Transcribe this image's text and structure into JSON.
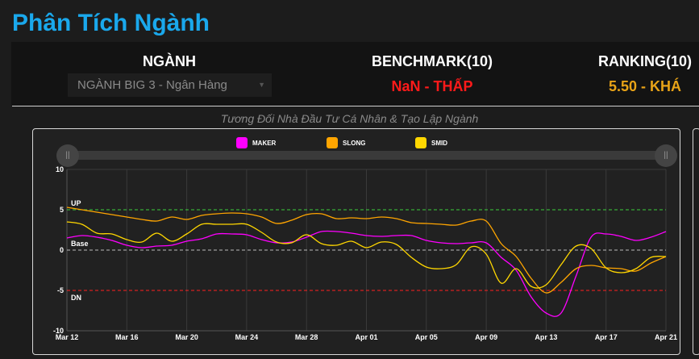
{
  "page_title": "Phân Tích Ngành",
  "header": {
    "sector_label": "NGÀNH",
    "sector_select_value": "NGÀNH BIG 3 - Ngân Hàng",
    "benchmark_label": "BENCHMARK(10)",
    "benchmark_value": "NaN - THẤP",
    "benchmark_color": "#ff1a1a",
    "ranking_label": "RANKING(10)",
    "ranking_value": "5.50 - KHÁ",
    "ranking_color": "#e8a317"
  },
  "chart_subtitle": "Tương Đối Nhà Đầu Tư Cá Nhân & Tạo Lập Ngành",
  "chart_data": {
    "type": "line",
    "title": "Tương Đối Nhà Đầu Tư Cá Nhân & Tạo Lập Ngành",
    "x_ticks": [
      "Mar 12",
      "Mar 16",
      "Mar 20",
      "Mar 24",
      "Mar 28",
      "Apr 01",
      "Apr 05",
      "Apr 09",
      "Apr 13",
      "Apr 17",
      "Apr 21"
    ],
    "x_day_count": 40,
    "ylim": [
      -10,
      10
    ],
    "y_ticks": [
      10,
      5,
      0,
      -5,
      -10
    ],
    "grid": true,
    "legend_position": "top-center",
    "reference_lines": [
      {
        "label": "UP",
        "value": 5,
        "color": "#3ccf3c"
      },
      {
        "label": "Base",
        "value": 0,
        "color": "#bbbbbb"
      },
      {
        "label": "DN",
        "value": -5,
        "color": "#ff2020"
      }
    ],
    "series": [
      {
        "name": "MAKER",
        "color": "#ff00ff",
        "values": [
          1.5,
          1.8,
          1.6,
          1.2,
          0.6,
          0.3,
          0.5,
          0.6,
          1.1,
          1.4,
          2.0,
          2.0,
          1.9,
          1.3,
          0.9,
          1.0,
          1.6,
          2.3,
          2.3,
          2.1,
          1.8,
          1.7,
          1.8,
          1.8,
          1.2,
          0.9,
          0.8,
          0.9,
          0.9,
          -0.9,
          -2.5,
          -5.8,
          -7.8,
          -7.8,
          -3.2,
          1.6,
          2.0,
          1.7,
          1.2,
          1.6,
          2.3
        ]
      },
      {
        "name": "SLONG",
        "color": "#ffa500",
        "values": [
          5.3,
          5.0,
          4.7,
          4.4,
          4.1,
          3.8,
          3.6,
          4.1,
          3.8,
          4.3,
          4.5,
          4.6,
          4.5,
          4.1,
          3.3,
          3.7,
          4.4,
          4.5,
          3.9,
          4.0,
          3.9,
          4.1,
          3.9,
          3.4,
          3.3,
          3.2,
          3.1,
          3.6,
          3.6,
          0.8,
          -0.8,
          -3.5,
          -5.3,
          -4.0,
          -2.3,
          -1.9,
          -2.2,
          -2.3,
          -2.6,
          -1.6,
          -0.8
        ]
      },
      {
        "name": "SMID",
        "color": "#ffd700",
        "values": [
          3.5,
          3.2,
          2.1,
          2.0,
          1.3,
          1.0,
          2.1,
          1.1,
          2.0,
          3.2,
          3.2,
          3.2,
          3.2,
          2.2,
          1.0,
          0.9,
          1.9,
          0.8,
          0.6,
          1.1,
          0.3,
          1.0,
          0.7,
          -0.9,
          -2.1,
          -2.3,
          -1.8,
          0.4,
          -0.5,
          -4.1,
          -2.3,
          -4.5,
          -4.3,
          -1.8,
          0.5,
          0.2,
          -2.2,
          -2.8,
          -2.3,
          -0.9,
          -0.8
        ]
      }
    ]
  }
}
